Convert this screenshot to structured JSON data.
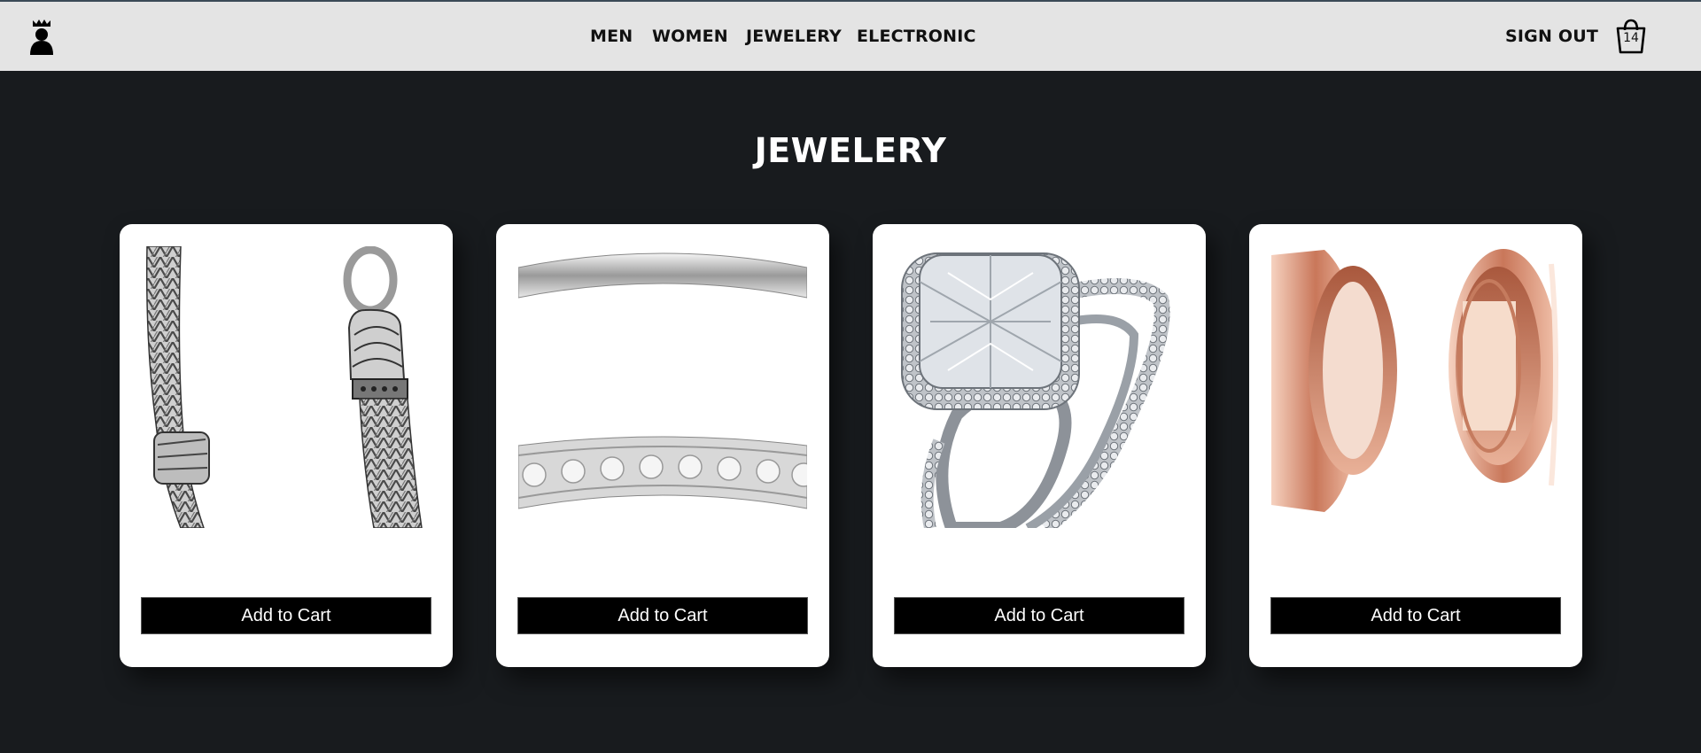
{
  "header": {
    "nav": [
      "MEN",
      "WOMEN",
      "JEWELERY",
      "ELECTRONIC"
    ],
    "sign_out": "SIGN OUT",
    "cart_count": "14"
  },
  "page": {
    "title": "JEWELERY"
  },
  "products": [
    {
      "image": "silver-chain-bracelet-image",
      "button": "Add to Cart"
    },
    {
      "image": "diamond-band-ring-image",
      "button": "Add to Cart"
    },
    {
      "image": "cushion-diamond-ring-set-image",
      "button": "Add to Cart"
    },
    {
      "image": "rose-gold-tunnel-plugs-image",
      "button": "Add to Cart"
    }
  ],
  "colors": {
    "header_bg": "#e4e4e4",
    "page_bg": "#181b1e",
    "card_bg": "#ffffff",
    "button_bg": "#000000",
    "button_text": "#ffffff"
  }
}
